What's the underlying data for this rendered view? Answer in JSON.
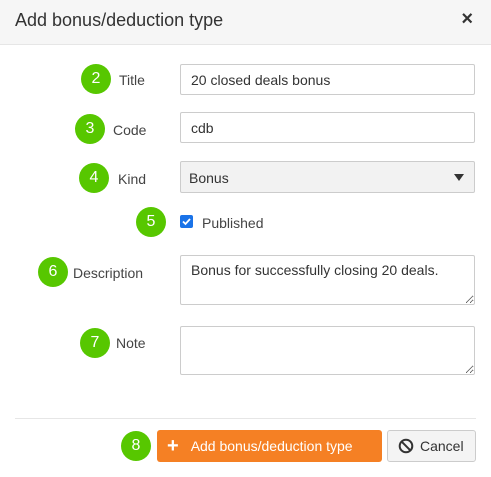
{
  "dialog": {
    "title": "Add bonus/deduction type",
    "close_label": "×"
  },
  "form": {
    "title": {
      "badge": "2",
      "label": "Title",
      "value": "20 closed deals bonus"
    },
    "code": {
      "badge": "3",
      "label": "Code",
      "value": "cdb"
    },
    "kind": {
      "badge": "4",
      "label": "Kind",
      "value": "Bonus"
    },
    "published": {
      "badge": "5",
      "label": "Published",
      "checked": true
    },
    "description": {
      "badge": "6",
      "label": "Description",
      "value": "Bonus for successfully closing 20 deals."
    },
    "note": {
      "badge": "7",
      "label": "Note",
      "value": ""
    }
  },
  "footer": {
    "badge": "8",
    "submit_icon": "+",
    "submit_label": "Add bonus/deduction type",
    "cancel_label": "Cancel"
  },
  "colors": {
    "badge": "#57c700",
    "primary": "#f58024",
    "checkbox": "#1a73e8"
  },
  "icons": [
    "close-icon",
    "plus-icon",
    "chevron-down-icon",
    "checkmark-icon",
    "ban-icon"
  ]
}
